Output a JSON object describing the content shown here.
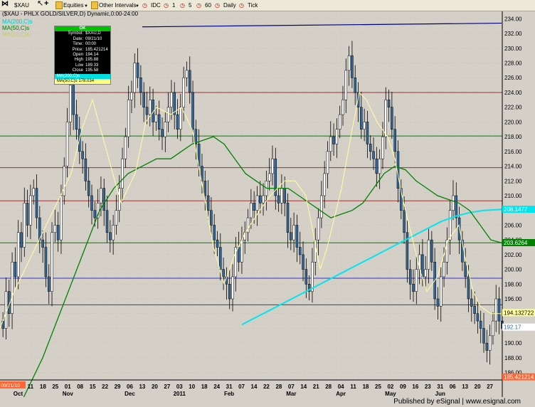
{
  "toolbar": {
    "symbol": "$XAU",
    "equities_label": "Equities",
    "other_intervals_label": "Other Intervals",
    "idc_label": "IDC",
    "i1_label": "1",
    "i5_label": "5",
    "i60_label": "60",
    "daily_label": "Daily",
    "tick_label": "Tick"
  },
  "legend": {
    "title": "($XAU - PHLX GOLD/SILVER,D) Dynamic,0:00-24:00",
    "ma200": "MA(200,C)s",
    "ma50": "MA(50,C)s",
    "ma10": "MA(10,C)s"
  },
  "tooltip": {
    "header": "OK",
    "rows": [
      {
        "k": "Symbol:",
        "v": "$XAU,D"
      },
      {
        "k": "Date:",
        "v": "09/21/10"
      },
      {
        "k": "Time:",
        "v": "00:00"
      },
      {
        "k": "Price:",
        "v": "185.421214"
      },
      {
        "k": "Open",
        "v": "194.14"
      },
      {
        "k": "High",
        "v": "195.88"
      },
      {
        "k": "Low",
        "v": "189.33"
      },
      {
        "k": "Close",
        "v": "195.58"
      }
    ],
    "ma200_row": "MA(200,C)s",
    "ma50_row": "MA(50,C)s 178.034"
  },
  "footer": {
    "text": "Published by eSignal  |  www.esignal.com"
  },
  "colors": {
    "background": "#d4d0c8",
    "candle_up": "#ffffff",
    "candle_down": "#336699",
    "ma10": "#ffffa0",
    "ma50": "#008000",
    "ma200": "#00e5ee",
    "trendline": "#000080",
    "hline_red": "#993333",
    "hline_green": "#008000",
    "hline_blue": "#3333cc"
  },
  "chart_data": {
    "type": "candlestick",
    "ylim": [
      185,
      235
    ],
    "yticks": [
      "234.00",
      "232.00",
      "230.00",
      "228.00",
      "226.00",
      "224.00",
      "222.00",
      "220.00",
      "218.00",
      "216.00",
      "214.00",
      "212.00",
      "210.00",
      "208.00",
      "206.00",
      "204.00",
      "202.00",
      "200.00",
      "198.00",
      "196.00",
      "194.00",
      "192.00",
      "190.00",
      "188.00",
      "186.00"
    ],
    "xticks": [
      "27",
      "04",
      "11",
      "18",
      "25",
      "01",
      "08",
      "15",
      "22",
      "29",
      "06",
      "13",
      "20",
      "27",
      "03",
      "10",
      "18",
      "24",
      "31",
      "07",
      "14",
      "22",
      "28",
      "07",
      "14",
      "21",
      "28",
      "04",
      "11",
      "18",
      "25",
      "02",
      "09",
      "16",
      "23",
      "31",
      "06",
      "13",
      "20",
      "27"
    ],
    "months": [
      "Oct",
      "Nov",
      "Dec",
      "2011",
      "Feb",
      "Mar",
      "Apr",
      "May",
      "Jun"
    ],
    "start_date_label": "09/21/10",
    "horizontal_lines": [
      {
        "value": 224.0,
        "color": "#993333"
      },
      {
        "value": 218.1,
        "color": "#008000"
      },
      {
        "value": 213.8,
        "color": "#993333"
      },
      {
        "value": 209.3,
        "color": "#993333"
      },
      {
        "value": 203.6,
        "color": "#008000"
      },
      {
        "value": 198.8,
        "color": "#3333cc"
      },
      {
        "value": 195.2,
        "color": "#444444"
      }
    ],
    "trendline": {
      "from": [
        200,
        232.9
      ],
      "to": [
        705,
        233.4
      ]
    },
    "price_tags": [
      {
        "text": "208.1477",
        "value": 208.15,
        "bg": "#00e5ee",
        "fg": "#ffffff"
      },
      {
        "text": "203.6264",
        "value": 203.63,
        "bg": "#008000",
        "fg": "#ffffff"
      },
      {
        "text": "194.132722",
        "value": 194.13,
        "bg": "#ffffa0",
        "fg": "#000000"
      },
      {
        "text": "192.17",
        "value": 192.17,
        "bg": "#ffffff",
        "fg": "#336699"
      },
      {
        "text": "185.421214",
        "value": 185.42,
        "bg": "#ff6633",
        "fg": "#ffffff"
      }
    ],
    "closes": [
      192,
      197,
      194,
      201,
      199,
      205,
      203,
      209,
      206,
      210,
      211,
      207,
      204,
      203,
      199,
      197,
      205,
      206,
      204,
      210,
      214,
      220,
      225,
      221,
      219,
      216,
      215,
      212,
      210,
      208,
      207,
      209,
      211,
      208,
      205,
      204,
      206,
      208,
      211,
      215,
      218,
      223,
      224,
      228,
      226,
      224,
      222,
      221,
      223,
      220,
      221,
      219,
      218,
      220,
      222,
      224,
      221,
      219,
      222,
      226,
      227,
      224,
      219,
      217,
      214,
      212,
      210,
      208,
      206,
      204,
      203,
      200,
      199,
      198,
      196,
      199,
      203,
      201,
      204,
      205,
      207,
      209,
      208,
      210,
      209,
      210,
      212,
      213,
      215,
      210,
      209,
      211,
      209,
      205,
      204,
      206,
      203,
      202,
      200,
      198,
      197,
      201,
      204,
      207,
      210,
      213,
      216,
      218,
      217,
      219,
      221,
      223,
      227,
      229,
      226,
      224,
      222,
      219,
      220,
      217,
      216,
      215,
      213,
      215,
      218,
      223,
      222,
      219,
      216,
      211,
      208,
      205,
      200,
      198,
      197,
      200,
      202,
      199,
      200,
      204,
      201,
      196,
      195,
      199,
      201,
      204,
      208,
      210,
      207,
      204,
      201,
      199,
      196,
      195,
      194,
      193,
      192,
      190,
      189,
      191,
      193,
      196,
      193,
      192
    ],
    "ma10": [
      [
        0,
        192
      ],
      [
        20,
        197
      ],
      [
        40,
        201
      ],
      [
        60,
        205
      ],
      [
        80,
        209
      ],
      [
        100,
        213
      ],
      [
        115,
        219
      ],
      [
        130,
        223
      ],
      [
        150,
        216
      ],
      [
        170,
        209
      ],
      [
        190,
        213
      ],
      [
        205,
        220
      ],
      [
        220,
        222
      ],
      [
        240,
        221
      ],
      [
        255,
        222
      ],
      [
        270,
        219
      ],
      [
        285,
        211
      ],
      [
        300,
        203
      ],
      [
        315,
        198
      ],
      [
        330,
        202
      ],
      [
        345,
        205
      ],
      [
        365,
        208
      ],
      [
        380,
        210
      ],
      [
        400,
        212
      ],
      [
        415,
        212
      ],
      [
        430,
        210
      ],
      [
        440,
        205
      ],
      [
        450,
        200
      ],
      [
        460,
        203
      ],
      [
        470,
        207
      ],
      [
        480,
        211
      ],
      [
        495,
        219
      ],
      [
        505,
        224
      ],
      [
        515,
        223
      ],
      [
        530,
        220
      ],
      [
        545,
        218
      ],
      [
        555,
        215
      ],
      [
        565,
        210
      ],
      [
        575,
        206
      ],
      [
        590,
        200
      ],
      [
        600,
        197
      ],
      [
        615,
        199
      ],
      [
        630,
        204
      ],
      [
        645,
        206
      ],
      [
        655,
        201
      ],
      [
        665,
        197
      ],
      [
        675,
        195
      ],
      [
        690,
        194
      ],
      [
        705,
        194
      ]
    ],
    "ma50": [
      [
        0,
        179
      ],
      [
        20,
        180
      ],
      [
        40,
        184
      ],
      [
        60,
        188
      ],
      [
        80,
        193
      ],
      [
        100,
        198
      ],
      [
        120,
        203
      ],
      [
        140,
        208
      ],
      [
        160,
        211
      ],
      [
        180,
        213
      ],
      [
        200,
        214
      ],
      [
        220,
        215
      ],
      [
        240,
        215
      ],
      [
        255,
        216
      ],
      [
        270,
        217
      ],
      [
        285,
        217.5
      ],
      [
        300,
        218
      ],
      [
        315,
        217
      ],
      [
        330,
        215
      ],
      [
        345,
        213
      ],
      [
        360,
        212
      ],
      [
        375,
        211
      ],
      [
        390,
        211
      ],
      [
        405,
        211
      ],
      [
        420,
        210
      ],
      [
        435,
        209
      ],
      [
        450,
        208
      ],
      [
        465,
        207
      ],
      [
        480,
        207.5
      ],
      [
        495,
        208
      ],
      [
        510,
        209
      ],
      [
        525,
        211
      ],
      [
        540,
        213
      ],
      [
        555,
        214
      ],
      [
        570,
        213.5
      ],
      [
        585,
        212
      ],
      [
        600,
        211
      ],
      [
        615,
        210
      ],
      [
        630,
        209.5
      ],
      [
        645,
        209
      ],
      [
        660,
        208
      ],
      [
        675,
        206
      ],
      [
        690,
        204
      ],
      [
        705,
        203.6
      ]
    ],
    "ma200": [
      [
        340,
        192.5
      ],
      [
        360,
        193.5
      ],
      [
        380,
        194.5
      ],
      [
        400,
        195.5
      ],
      [
        420,
        196.5
      ],
      [
        440,
        197.5
      ],
      [
        460,
        198.5
      ],
      [
        480,
        199.5
      ],
      [
        500,
        200.5
      ],
      [
        520,
        201.5
      ],
      [
        540,
        202.5
      ],
      [
        560,
        203.5
      ],
      [
        580,
        204.5
      ],
      [
        600,
        205.5
      ],
      [
        620,
        206.5
      ],
      [
        640,
        207.2
      ],
      [
        660,
        207.7
      ],
      [
        680,
        208
      ],
      [
        705,
        208.15
      ]
    ]
  }
}
